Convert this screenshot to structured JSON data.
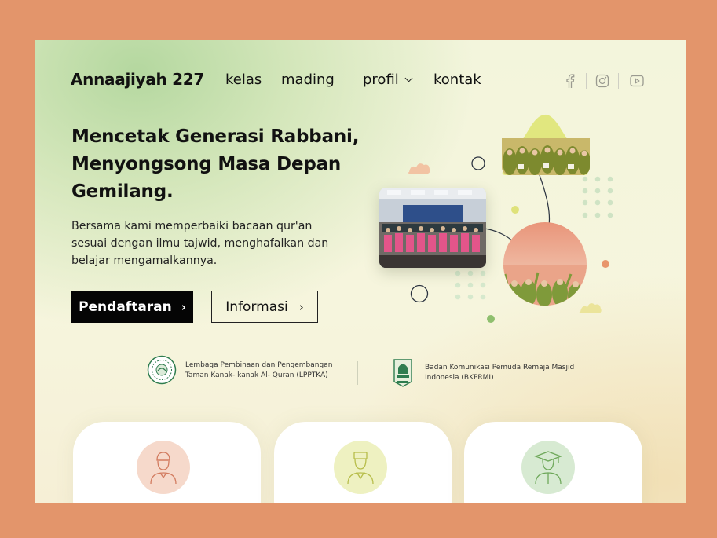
{
  "header": {
    "brand": "Annaajiyah 227",
    "nav": [
      {
        "label": "kelas"
      },
      {
        "label": "mading"
      },
      {
        "label": "profil"
      },
      {
        "label": "kontak"
      }
    ],
    "social_icons": [
      "facebook-icon",
      "instagram-icon",
      "youtube-icon"
    ]
  },
  "hero": {
    "headline": "Mencetak Generasi Rabbani, Menyongsong Masa Depan Gemilang.",
    "description": "Bersama kami memperbaiki bacaan qur'an sesuai dengan ilmu tajwid, menghafalkan dan belajar mengamalkannya.",
    "primary_button": "Pendaftaran",
    "secondary_button": "Informasi",
    "button_arrow": "›"
  },
  "partners": [
    {
      "name": "Lembaga Pembinaan dan Pengembangan Taman Kanak- kanak Al- Quran (LPPTKA)"
    },
    {
      "name": "Badan Komunikasi Pemuda Remaja Masjid Indonesia (BKPRMI)"
    }
  ],
  "cards": [
    {
      "icon": "boy-with-cap-icon",
      "accent": "#f6d9cb"
    },
    {
      "icon": "person-icon",
      "accent": "#eef1c1"
    },
    {
      "icon": "graduate-icon",
      "accent": "#d7ead2"
    }
  ],
  "colors": {
    "frame": "#e3956b",
    "primary_button": "#050505",
    "accent_green": "#8fbf6e",
    "accent_orange": "#e8956b"
  }
}
